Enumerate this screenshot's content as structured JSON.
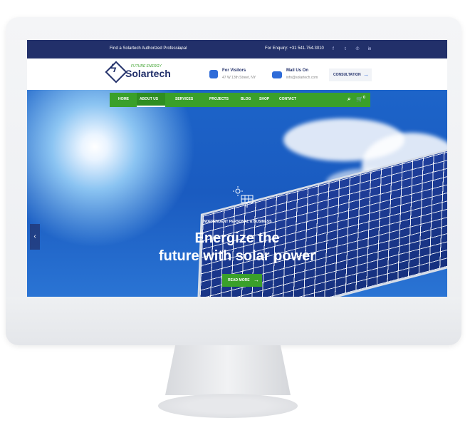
{
  "topbar": {
    "find_text": "Find a Solartech Authorized Professional",
    "enquiry_text": "For Enquiry: +31 541.754.3010",
    "social": [
      "f",
      "t",
      "in"
    ]
  },
  "header": {
    "logo_tagline": "FUTURE ENERGY",
    "logo_name": "Solartech",
    "visitors_title": "For Visitors",
    "visitors_sub": "47 W 13th Street, NY",
    "mail_title": "Mail Us On",
    "mail_sub": "info@solartech.com",
    "consult_label": "CONSULTATION"
  },
  "nav": {
    "items": [
      "HOME",
      "ABOUT US",
      "SERVICES",
      "PROJECTS",
      "BLOG",
      "SHOP",
      "CONTACT"
    ],
    "cart_count": "0"
  },
  "hero": {
    "kicker": "INDEPENDENT PERSONAL & BUSINESS",
    "title_line1": "Energize the",
    "title_line2": "future with solar power",
    "cta_label": "READ MORE"
  },
  "colors": {
    "navy": "#22306a",
    "green": "#3aa02a",
    "blue": "#2e6bd8"
  }
}
